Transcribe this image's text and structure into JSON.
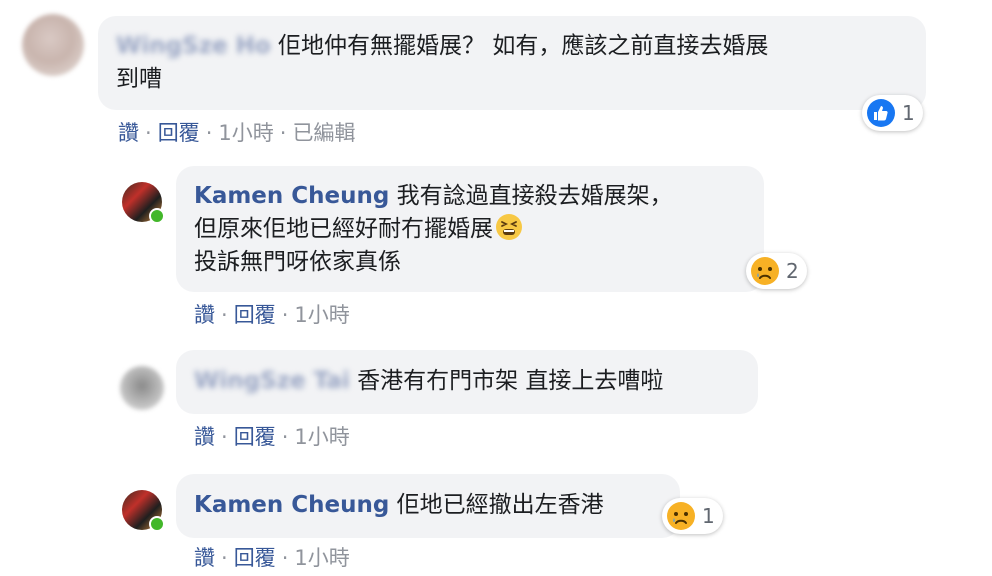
{
  "comments": [
    {
      "author": "WingSze Ho",
      "text_line1": "佢地仲有無擺婚展？ 如有，應該之前直接去婚展",
      "text_line2": "到嘈",
      "actions": {
        "like": "讚",
        "reply": "回覆",
        "time": "1小時",
        "edited": "已編輯"
      },
      "reaction": {
        "icon": "like-icon",
        "count": "1",
        "color": "#1877f2"
      }
    },
    {
      "author": "Kamen Cheung",
      "text_line1": "我有諗過直接殺去婚展架，",
      "text_line2": "但原來佢地已經好耐冇擺婚展",
      "text_line3": "投訴無門呀依家真係",
      "inline_emoji": "tired-face-emoji",
      "actions": {
        "like": "讚",
        "reply": "回覆",
        "time": "1小時"
      },
      "reaction": {
        "icon": "sad-face-icon",
        "count": "2",
        "color": "#f7b125"
      }
    },
    {
      "author": "WingSze Tai",
      "text_line1": "香港有冇門市架 直接上去嘈啦",
      "actions": {
        "like": "讚",
        "reply": "回覆",
        "time": "1小時"
      }
    },
    {
      "author": "Kamen Cheung",
      "text_line1": "佢地已經撤出左香港",
      "actions": {
        "like": "讚",
        "reply": "回覆",
        "time": "1小時"
      },
      "reaction": {
        "icon": "sad-face-icon",
        "count": "1",
        "color": "#f7b125"
      }
    }
  ]
}
